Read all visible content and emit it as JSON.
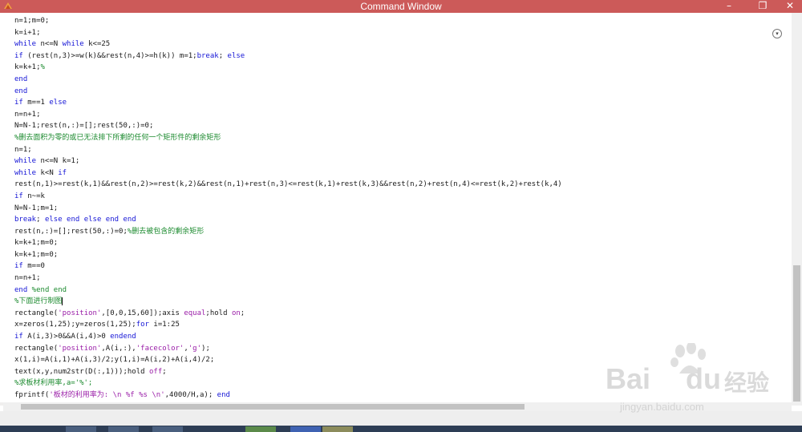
{
  "window": {
    "title": "Command Window",
    "minimize_icon": "minimize-icon",
    "restore_icon": "restore-icon",
    "close_icon": "close-icon"
  },
  "code_lines": [
    [
      {
        "t": "n=1;m=0;",
        "c": "plain"
      }
    ],
    [
      {
        "t": "k=i+1;",
        "c": "plain"
      }
    ],
    [
      {
        "t": "while",
        "c": "kw"
      },
      {
        "t": " n<=N ",
        "c": "plain"
      },
      {
        "t": "while",
        "c": "kw"
      },
      {
        "t": " k<=25",
        "c": "plain"
      }
    ],
    [
      {
        "t": "if",
        "c": "kw"
      },
      {
        "t": " (rest(n,3)>=w(k)&&rest(n,4)>=h(k)) m=1;",
        "c": "plain"
      },
      {
        "t": "break",
        "c": "kw"
      },
      {
        "t": "; ",
        "c": "plain"
      },
      {
        "t": "else",
        "c": "kw"
      }
    ],
    [
      {
        "t": "k=k+1;",
        "c": "plain"
      },
      {
        "t": "%",
        "c": "com"
      }
    ],
    [
      {
        "t": "end",
        "c": "kw"
      }
    ],
    [
      {
        "t": "end",
        "c": "kw"
      }
    ],
    [
      {
        "t": "if",
        "c": "kw"
      },
      {
        "t": " m==1 ",
        "c": "plain"
      },
      {
        "t": "else",
        "c": "kw"
      }
    ],
    [
      {
        "t": "n=n+1;",
        "c": "plain"
      }
    ],
    [
      {
        "t": "N=N-1;rest(n,:)=[];rest(50,:)=0;",
        "c": "plain"
      }
    ],
    [
      {
        "t": "%删去面积为零的或已无法排下所剩的任何一个矩形件的剩余矩形",
        "c": "com"
      }
    ],
    [
      {
        "t": "n=1;",
        "c": "plain"
      }
    ],
    [
      {
        "t": "while",
        "c": "kw"
      },
      {
        "t": " n<=N k=1;",
        "c": "plain"
      }
    ],
    [
      {
        "t": "while",
        "c": "kw"
      },
      {
        "t": " k<N ",
        "c": "plain"
      },
      {
        "t": "if",
        "c": "kw"
      }
    ],
    [
      {
        "t": "rest(n,1)>=rest(k,1)&&rest(n,2)>=rest(k,2)&&rest(n,1)+rest(n,3)<=rest(k,1)+rest(k,3)&&rest(n,2)+rest(n,4)<=rest(k,2)+rest(k,4)",
        "c": "plain"
      }
    ],
    [
      {
        "t": "if",
        "c": "kw"
      },
      {
        "t": " n~=k",
        "c": "plain"
      }
    ],
    [
      {
        "t": "N=N-1;m=1;",
        "c": "plain"
      }
    ],
    [
      {
        "t": "break",
        "c": "kw"
      },
      {
        "t": "; ",
        "c": "plain"
      },
      {
        "t": "else end else end end",
        "c": "kw"
      }
    ],
    [
      {
        "t": "rest(n,:)=[];rest(50,:)=0;",
        "c": "plain"
      },
      {
        "t": "%删去被包含的剩余矩形",
        "c": "com"
      }
    ],
    [
      {
        "t": "k=k+1;m=0;",
        "c": "plain"
      }
    ],
    [
      {
        "t": "k=k+1;m=0;",
        "c": "plain"
      }
    ],
    [
      {
        "t": "if",
        "c": "kw"
      },
      {
        "t": " m==0",
        "c": "plain"
      }
    ],
    [
      {
        "t": "n=n+1;",
        "c": "plain"
      }
    ],
    [
      {
        "t": "end",
        "c": "kw"
      },
      {
        "t": " %end end",
        "c": "com"
      }
    ],
    [
      {
        "t": "%下面进行制图",
        "c": "com"
      }
    ],
    [
      {
        "t": "rectangle(",
        "c": "plain"
      },
      {
        "t": "'position'",
        "c": "str"
      },
      {
        "t": ",[0,0,15,60]);axis ",
        "c": "plain"
      },
      {
        "t": "equal",
        "c": "str"
      },
      {
        "t": ";hold ",
        "c": "plain"
      },
      {
        "t": "on",
        "c": "str"
      },
      {
        "t": ";",
        "c": "plain"
      }
    ],
    [
      {
        "t": "x=zeros(1,25);y=zeros(1,25);",
        "c": "plain"
      },
      {
        "t": "for",
        "c": "kw"
      },
      {
        "t": " i=1:25",
        "c": "plain"
      }
    ],
    [
      {
        "t": "if",
        "c": "kw"
      },
      {
        "t": " A(i,3)>0&&A(i,4)>0 ",
        "c": "plain"
      },
      {
        "t": "endend",
        "c": "kw"
      }
    ],
    [
      {
        "t": "rectangle(",
        "c": "plain"
      },
      {
        "t": "'position'",
        "c": "str"
      },
      {
        "t": ",A(i,:),",
        "c": "plain"
      },
      {
        "t": "'facecolor'",
        "c": "str"
      },
      {
        "t": ",",
        "c": "plain"
      },
      {
        "t": "'g'",
        "c": "str"
      },
      {
        "t": ");",
        "c": "plain"
      }
    ],
    [
      {
        "t": "x(1,i)=A(i,1)+A(i,3)/2;y(1,i)=A(i,2)+A(i,4)/2;",
        "c": "plain"
      }
    ],
    [
      {
        "t": "text(x,y,num2str(D(:,1)));hold ",
        "c": "plain"
      },
      {
        "t": "off",
        "c": "str"
      },
      {
        "t": ";",
        "c": "plain"
      }
    ],
    [
      {
        "t": "%求板材利用率,a='%';",
        "c": "com"
      }
    ],
    [
      {
        "t": "fprintf(",
        "c": "plain"
      },
      {
        "t": "'板材的利用率为: \\n %f %s \\n'",
        "c": "str"
      },
      {
        "t": ",4000/H,a); ",
        "c": "plain"
      },
      {
        "t": "end",
        "c": "kw"
      }
    ]
  ],
  "watermark": {
    "brand_left": "Bai",
    "brand_right": "du",
    "brand_cn": "经验",
    "url": "jingyan.baidu.com"
  },
  "colors": {
    "titlebar": "#cc5a59",
    "keyword": "#1515d6",
    "string": "#9a1ea8",
    "comment": "#1b8a2e"
  }
}
